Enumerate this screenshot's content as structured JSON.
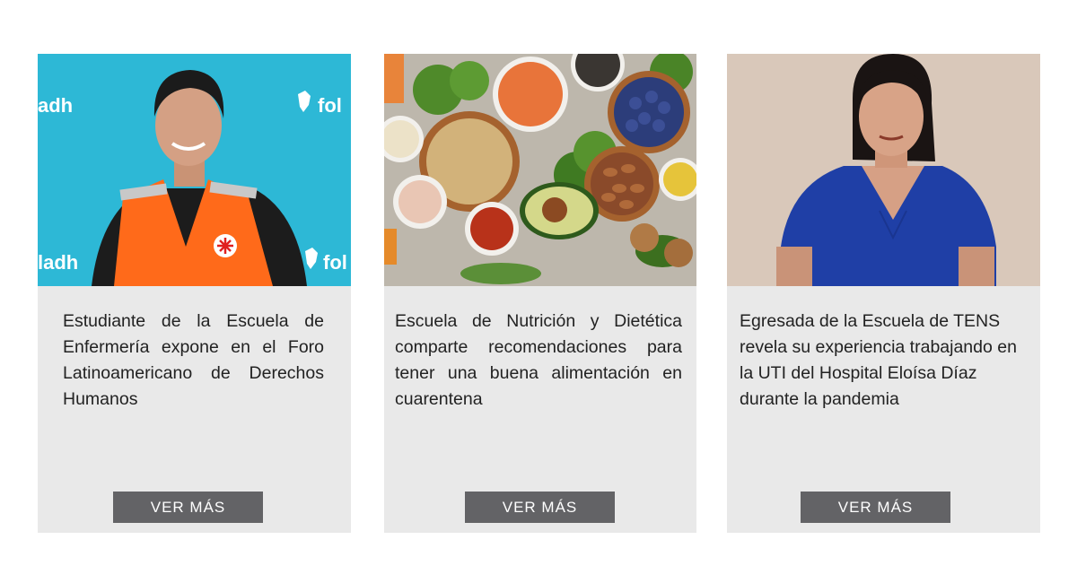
{
  "cards": [
    {
      "image_alt": "Estudiante con chaleco naranja frente a un fondo celeste con logo foladh",
      "photo_logo_texts": [
        "adh",
        "fol",
        "ladh",
        "fol"
      ],
      "title": "Estudiante de la Escuela de Enfermería expone en el Foro Latinoamericano de Derechos Humanos",
      "button": "VER MÁS"
    },
    {
      "image_alt": "Alimentos saludables: legumbres, verduras, frutos secos y semillas",
      "title": "Escuela de Nutrición y Dietética comparte recomendaciones para tener una buena alimentación en cuarentena",
      "button": "VER MÁS"
    },
    {
      "image_alt": "Egresada con uniforme azul frente a una pared clara",
      "title": "Egresada de la Escuela de TENS revela su experiencia trabajando en la UTI del Hospital Eloísa Díaz durante la pandemia",
      "button": "VER MÁS"
    }
  ],
  "colors": {
    "card_background": "#e9e9e9",
    "button_background": "#636366",
    "button_text": "#ffffff",
    "text": "#222222"
  }
}
